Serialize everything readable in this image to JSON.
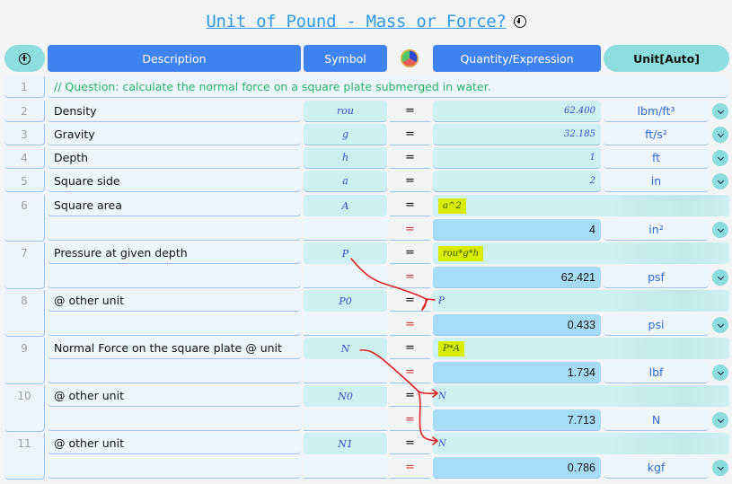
{
  "title": "Unit of Pound - Mass or Force?",
  "header": {
    "add_icon": "plus-circle-icon",
    "description": "Description",
    "symbol": "Symbol",
    "color_icon": "color-wheel-icon",
    "quantity": "Quantity/Expression",
    "unit": "Unit[Auto]"
  },
  "rows": [
    {
      "n": "1",
      "description": "// Question: calculate the normal force on a square plate submerged in water."
    },
    {
      "n": "2",
      "description": "Density",
      "symbol": "rou",
      "eq": "=",
      "value": "62.400",
      "unit": "lbm/ft³"
    },
    {
      "n": "3",
      "description": "Gravity",
      "symbol": "g",
      "eq": "=",
      "value": "32.185",
      "unit": "ft/s²"
    },
    {
      "n": "4",
      "description": "Depth",
      "symbol": "h",
      "eq": "=",
      "value": "1",
      "unit": "ft"
    },
    {
      "n": "5",
      "description": "Square side",
      "symbol": "a",
      "eq": "=",
      "value": "2",
      "unit": "in"
    },
    {
      "n": "6",
      "description": "Square area",
      "symbol": "A",
      "eq": "=",
      "expression": "a^2",
      "result_eq": "=",
      "result": "4",
      "unit": "in²"
    },
    {
      "n": "7",
      "description": "Pressure at given depth",
      "symbol": "P",
      "eq": "=",
      "expression": "rou*g*h",
      "result_eq": "=",
      "result": "62.421",
      "unit": "psf"
    },
    {
      "n": "8",
      "description": "@ other unit",
      "symbol": "P0",
      "eq": "=",
      "expression": "P",
      "result_eq": "=",
      "result": "0.433",
      "unit": "psi"
    },
    {
      "n": "9",
      "description": "Normal Force on the square plate @ unit",
      "symbol": "N",
      "eq": "=",
      "expression": "P*A",
      "result_eq": "=",
      "result": "1.734",
      "unit": "lbf"
    },
    {
      "n": "10",
      "description": "@ other unit",
      "symbol": "N0",
      "eq": "=",
      "expression": "N",
      "result_eq": "=",
      "result": "7.713",
      "unit": "N"
    },
    {
      "n": "11",
      "description": "@ other unit",
      "symbol": "N1",
      "eq": "=",
      "expression": "N",
      "result_eq": "=",
      "result": "0.786",
      "unit": "kgf"
    }
  ],
  "colors": {
    "header_blue": "#3f83f2",
    "header_teal": "#8cdddd",
    "comment_green": "#27b463",
    "highlight_yellow": "#dbeb00",
    "arrow_red": "#e02020"
  }
}
